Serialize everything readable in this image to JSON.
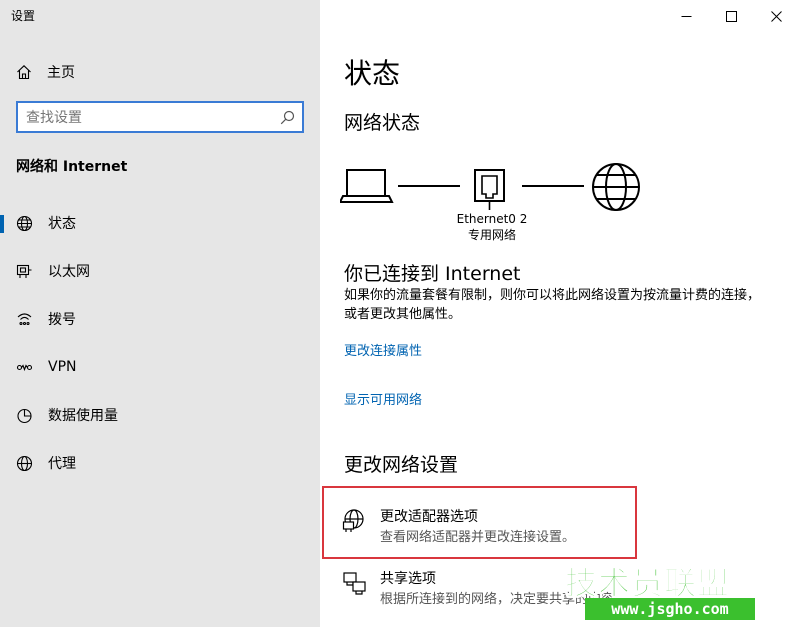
{
  "app": {
    "title": "设置"
  },
  "sidebar": {
    "home_label": "主页",
    "search_placeholder": "查找设置",
    "section_title": "网络和 Internet",
    "items": [
      {
        "label": "状态",
        "icon": "globe-icon",
        "selected": true
      },
      {
        "label": "以太网",
        "icon": "ethernet-icon",
        "selected": false
      },
      {
        "label": "拨号",
        "icon": "dialup-icon",
        "selected": false
      },
      {
        "label": "VPN",
        "icon": "vpn-icon",
        "selected": false
      },
      {
        "label": "数据使用量",
        "icon": "data-usage-icon",
        "selected": false
      },
      {
        "label": "代理",
        "icon": "globe-icon",
        "selected": false
      }
    ]
  },
  "main": {
    "title": "状态",
    "network_status_heading": "网络状态",
    "adapter_name": "Ethernet0 2",
    "network_type": "专用网络",
    "connected_title": "你已连接到 Internet",
    "connected_desc": "如果你的流量套餐有限制，则你可以将此网络设置为按流量计费的连接，或者更改其他属性。",
    "link_properties": "更改连接属性",
    "link_available": "显示可用网络",
    "change_heading": "更改网络设置",
    "options": [
      {
        "title": "更改适配器选项",
        "desc": "查看网络适配器并更改连接设置。",
        "icon": "adapter-icon"
      },
      {
        "title": "共享选项",
        "desc": "根据所连接到的网络，决定要共享的内容。",
        "icon": "sharing-icon"
      }
    ]
  },
  "watermark": {
    "top": "技术员联盟",
    "bottom": "www.jsgho.com"
  },
  "colors": {
    "sidebar_bg": "#e6e6e6",
    "accent": "#0063b1",
    "highlight": "#d9363e",
    "watermark": "#3bc02e"
  }
}
